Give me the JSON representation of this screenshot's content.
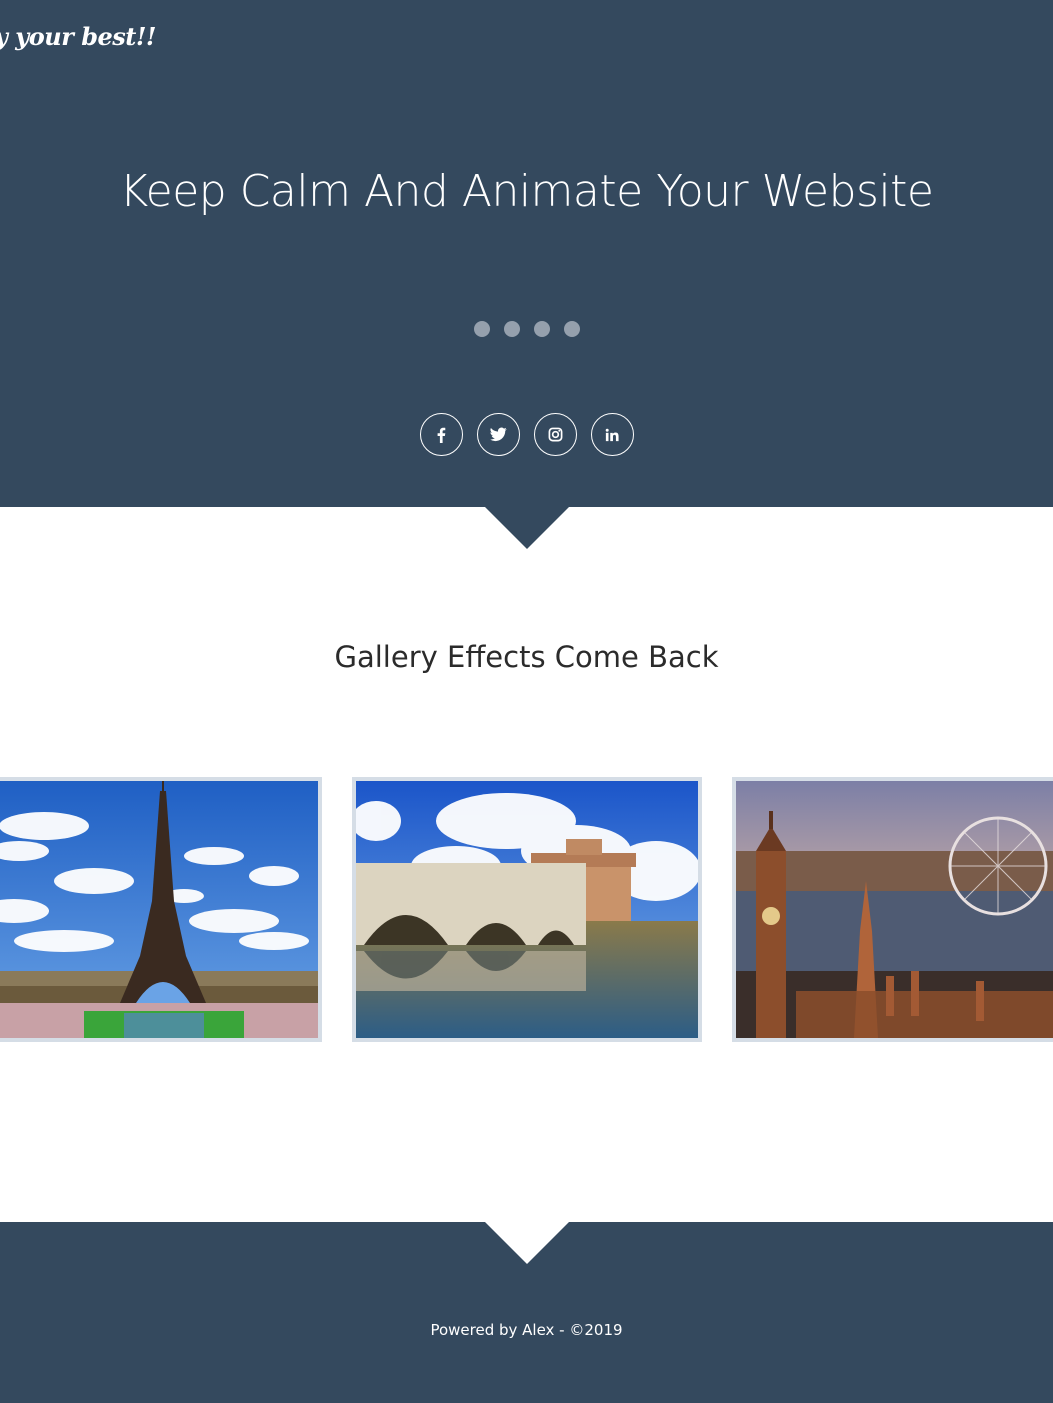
{
  "hero": {
    "tagline": "y your best!!",
    "title": "Keep Calm And Animate Your Website",
    "slide_dots": 4,
    "background_color": "#34495e",
    "social": [
      {
        "name": "facebook",
        "icon": "facebook-icon"
      },
      {
        "name": "twitter",
        "icon": "twitter-icon"
      },
      {
        "name": "instagram",
        "icon": "instagram-icon"
      },
      {
        "name": "linkedin",
        "icon": "linkedin-icon"
      }
    ]
  },
  "gallery": {
    "title": "Gallery Effects Come Back",
    "images": [
      {
        "subject": "eiffel-tower-paris"
      },
      {
        "subject": "castel-santangelo-rome"
      },
      {
        "subject": "big-ben-london-eye"
      }
    ]
  },
  "footer": {
    "text": "Powered by Alex - ©2019"
  }
}
